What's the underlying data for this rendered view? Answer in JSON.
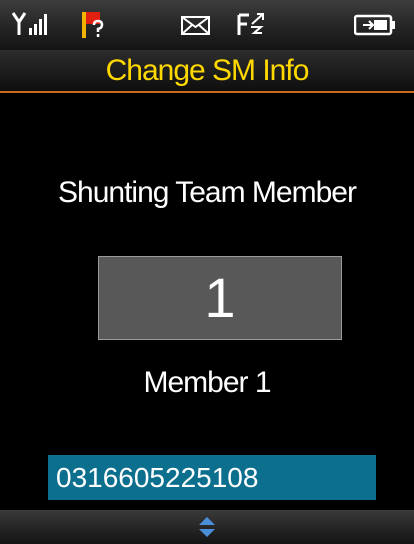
{
  "status_bar": {
    "icons": [
      "signal-strength-icon",
      "flag-unknown-icon",
      "mail-icon",
      "call-forward-icon",
      "battery-icon"
    ],
    "colors": {
      "flag": "#e02010",
      "icon": "#ffffff"
    }
  },
  "header": {
    "title": "Change SM Info",
    "title_color": "#ffd800",
    "divider_color": "#c8681a"
  },
  "main": {
    "section_label": "Shunting Team Member",
    "member_number": "1",
    "member_label": "Member 1",
    "phone_number": "0316605225108",
    "phone_field_color": "#0d6f8e"
  },
  "footer": {
    "scroll_indicator": "up-down-arrows-icon",
    "scroll_color": "#4a8fd8"
  }
}
